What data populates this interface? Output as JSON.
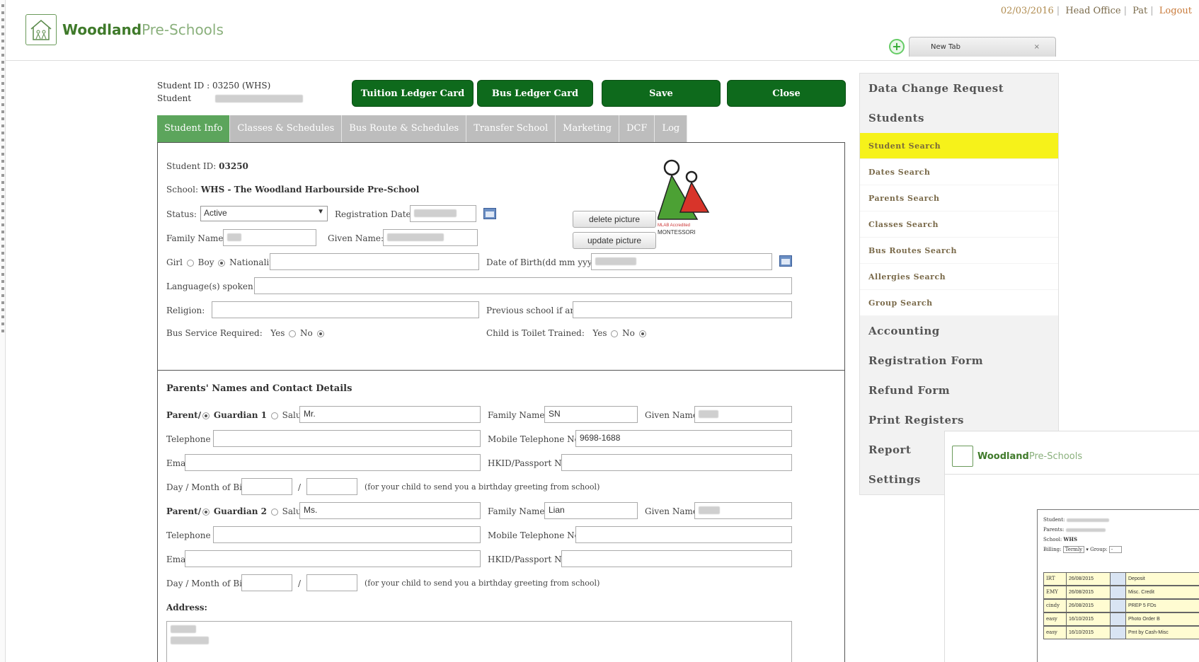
{
  "header": {
    "brand_bold": "Woodland",
    "brand_light": "Pre-Schools",
    "date": "02/03/2016",
    "office": "Head Office",
    "user": "Pat",
    "logout": "Logout",
    "new_tab": "New Tab",
    "new_tab_close": "×",
    "add_tab": "+"
  },
  "student_header": {
    "id_label": "Student ID : 03250 (WHS)",
    "student_label": "Student"
  },
  "actions": {
    "tuition": "Tuition Ledger Card",
    "bus": "Bus Ledger Card",
    "save": "Save",
    "close": "Close"
  },
  "tabs": [
    "Student Info",
    "Classes & Schedules",
    "Bus Route & Schedules",
    "Transfer School",
    "Marketing",
    "DCF",
    "Log"
  ],
  "student_info": {
    "id_label": "Student ID:",
    "id_value": "03250",
    "school_label": "School:",
    "school_value": "WHS - The Woodland Harbourside Pre-School",
    "status_label": "Status:",
    "status_value": "Active",
    "reg_date_label": "Registration Date:",
    "delete_picture": "delete picture",
    "update_picture": "update picture",
    "family_name_label": "Family Name:",
    "given_name_label": "Given Name:",
    "girl_label": "Girl",
    "boy_label": "Boy",
    "nationality_label": "Nationality:",
    "dob_label": "Date of Birth(dd mm yyyy):",
    "languages_label": "Language(s) spoken:",
    "religion_label": "Religion:",
    "previous_school_label": "Previous school if any:",
    "bus_label": "Bus Service Required:",
    "yes": "Yes",
    "no": "No",
    "toilet_label": "Child is Toilet Trained:",
    "montessori_small": "MLAB Accredited",
    "montessori": "MONTESSORI"
  },
  "parents": {
    "title": "Parents' Names and Contact Details",
    "parent_label": "Parent/",
    "guardian1": "Guardian 1",
    "guardian2": "Guardian 2",
    "salutation_label": "Salutation:",
    "g1_salutation": "Mr.",
    "g1_family_name": "SN",
    "g2_salutation": "Ms.",
    "g2_family_name": "Lian",
    "mobile_value": "9698-1688",
    "family_name_label": "Family Name:",
    "given_name_label": "Given Name:",
    "telephone_label": "Telephone no:",
    "mobile_label": "Mobile Telephone No:",
    "email_label": "Email:",
    "hkid_label": "HKID/Passport No.:",
    "dob_label": "Day / Month of Birth:",
    "slash": "/",
    "birthday_hint": "(for your child to send you a birthday greeting from school)",
    "address_label": "Address:"
  },
  "side_menu": {
    "data_change": "Data Change Request",
    "students": "Students",
    "sub": [
      "Student Search",
      "Dates Search",
      "Parents Search",
      "Classes Search",
      "Bus Routes Search",
      "Allergies Search",
      "Group Search"
    ],
    "accounting": "Accounting",
    "registration": "Registration Form",
    "refund": "Refund Form",
    "print": "Print Registers",
    "report": "Report",
    "settings": "Settings"
  },
  "overlay": {
    "brand_bold": "Woodland",
    "brand_light": "Pre-Schools",
    "student_label": "Student:",
    "parents_label": "Parents:",
    "school_label": "School:",
    "school_value": "WHS",
    "billing_label": "Billing:",
    "billing_value": "Termly",
    "group_label": "Group:",
    "group_value": "-",
    "rows": [
      {
        "code": "IRT",
        "date": "26/08/2015",
        "desc": "Deposit"
      },
      {
        "code": "EMY",
        "date": "26/08/2015",
        "desc": "Misc. Credit"
      },
      {
        "code": "cindy",
        "date": "26/08/2015",
        "desc": "PREP 5 FDs"
      },
      {
        "code": "easy",
        "date": "16/10/2015",
        "desc": "Photo Order B"
      },
      {
        "code": "easy",
        "date": "16/10/2015",
        "desc": "Pmt by Cash-Misc"
      }
    ]
  },
  "colors": {
    "action_green": "#0e6a1c",
    "tab_active": "#5ca55c",
    "menu_highlight": "#f6f21a"
  }
}
